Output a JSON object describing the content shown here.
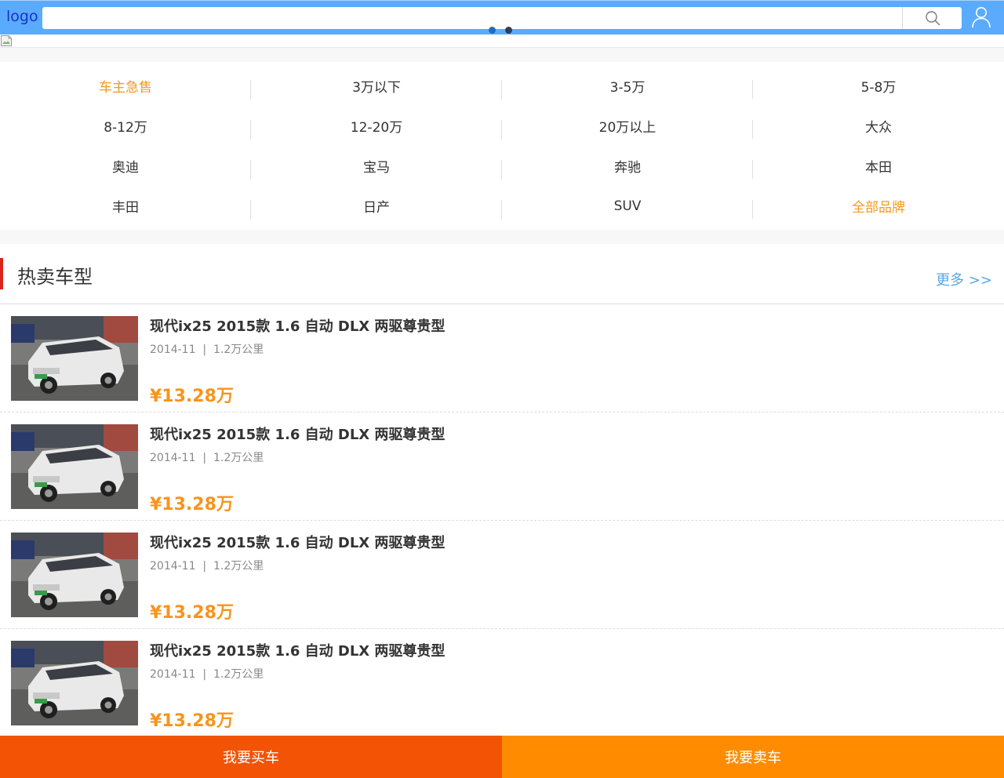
{
  "header": {
    "logo": "logo",
    "search_placeholder": "",
    "search_icon": "search-icon",
    "user_icon": "user-icon",
    "carousel_dots": 2,
    "colors": {
      "bar": "#5aabfd",
      "logo": "#1a2fd0"
    }
  },
  "categories": [
    {
      "label": "车主急售",
      "highlight": true
    },
    {
      "label": "3万以下",
      "highlight": false
    },
    {
      "label": "3-5万",
      "highlight": false
    },
    {
      "label": "5-8万",
      "highlight": false
    },
    {
      "label": "8-12万",
      "highlight": false
    },
    {
      "label": "12-20万",
      "highlight": false
    },
    {
      "label": "20万以上",
      "highlight": false
    },
    {
      "label": "大众",
      "highlight": false
    },
    {
      "label": "奥迪",
      "highlight": false
    },
    {
      "label": "宝马",
      "highlight": false
    },
    {
      "label": "奔驰",
      "highlight": false
    },
    {
      "label": "本田",
      "highlight": false
    },
    {
      "label": "丰田",
      "highlight": false
    },
    {
      "label": "日产",
      "highlight": false
    },
    {
      "label": "SUV",
      "highlight": false
    },
    {
      "label": "全部品牌",
      "highlight": true
    }
  ],
  "hot": {
    "title": "热卖车型",
    "more": "更多 >>",
    "items": [
      {
        "title": "现代ix25 2015款 1.6 自动 DLX 两驱尊贵型",
        "meta": "2014-11  |  1.2万公里",
        "price": "¥13.28万"
      },
      {
        "title": "现代ix25 2015款 1.6 自动 DLX 两驱尊贵型",
        "meta": "2014-11  |  1.2万公里",
        "price": "¥13.28万"
      },
      {
        "title": "现代ix25 2015款 1.6 自动 DLX 两驱尊贵型",
        "meta": "2014-11  |  1.2万公里",
        "price": "¥13.28万"
      },
      {
        "title": "现代ix25 2015款 1.6 自动 DLX 两驱尊贵型",
        "meta": "2014-11  |  1.2万公里",
        "price": "¥13.28万"
      }
    ]
  },
  "footer": {
    "buy": "我要买车",
    "sell": "我要卖车",
    "colors": {
      "buy": "#f25305",
      "sell": "#ff8c00"
    }
  }
}
